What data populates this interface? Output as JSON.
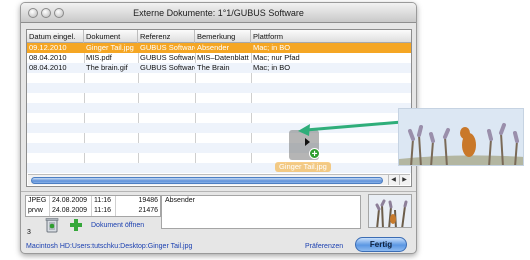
{
  "window": {
    "title": "Externe Dokumente: 1°1/GUBUS Software"
  },
  "table": {
    "columns": [
      "Datum eingel.",
      "Dokument",
      "Referenz",
      "Bemerkung",
      "Plattform"
    ],
    "rows": [
      [
        "09.12.2010",
        "Ginger Tail.jpg",
        "GUBUS Software",
        "Absender",
        "Mac; in BO"
      ],
      [
        "08.04.2010",
        "MIS.pdf",
        "GUBUS Software",
        "MIS–Datenblatt",
        "Mac; nur Pfad"
      ],
      [
        "08.04.2010",
        "The brain.gif",
        "GUBUS Software",
        "The Brain",
        "Mac; in BO"
      ]
    ]
  },
  "drag": {
    "label": "Ginger Tail.jpg"
  },
  "info": {
    "rows": [
      [
        "JPEG",
        "24.08.2009",
        "11:16",
        "19486"
      ],
      [
        "prvw",
        "24.08.2009",
        "11:16",
        "21476"
      ]
    ],
    "note": "Absender",
    "count": "3"
  },
  "actions": {
    "open": "Dokument öffnen",
    "path": "Macintosh HD:Users:tutschku:Desktop:Ginger Tail.jpg",
    "preferences": "Präferenzen",
    "done": "Fertig"
  },
  "colors": {
    "selection": "#f5a623",
    "accent": "#2f9e2f",
    "link": "#1a3fb0"
  }
}
